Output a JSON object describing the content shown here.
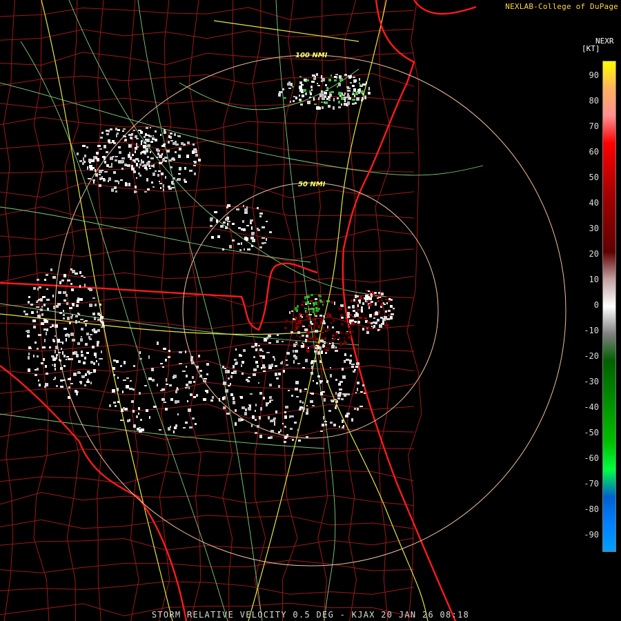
{
  "credit": "NEXLAB-College of DuPage",
  "product": "NEXR",
  "unit": "[KT]",
  "caption": "STORM RELATIVE VELOCITY 0.5 DEG - KJAX 20 JAN 26 08:18",
  "rings": [
    {
      "label": "50 NMI"
    },
    {
      "label": "100 NMI"
    }
  ],
  "scale": {
    "ticks": [
      "90",
      "80",
      "70",
      "60",
      "50",
      "40",
      "30",
      "20",
      "10",
      "0",
      "-10",
      "-20",
      "-30",
      "-40",
      "-50",
      "-60",
      "-70",
      "-80",
      "-90"
    ],
    "colors": [
      "#ffff00",
      "#ffb060",
      "#ff9090",
      "#ff0000",
      "#d00000",
      "#a00000",
      "#800000",
      "#600000",
      "#c0a0a0",
      "#ffffff",
      "#808080",
      "#006000",
      "#008000",
      "#00a000",
      "#00c000",
      "#00ff40",
      "#0060d0",
      "#0080ff",
      "#00a0ff"
    ]
  }
}
